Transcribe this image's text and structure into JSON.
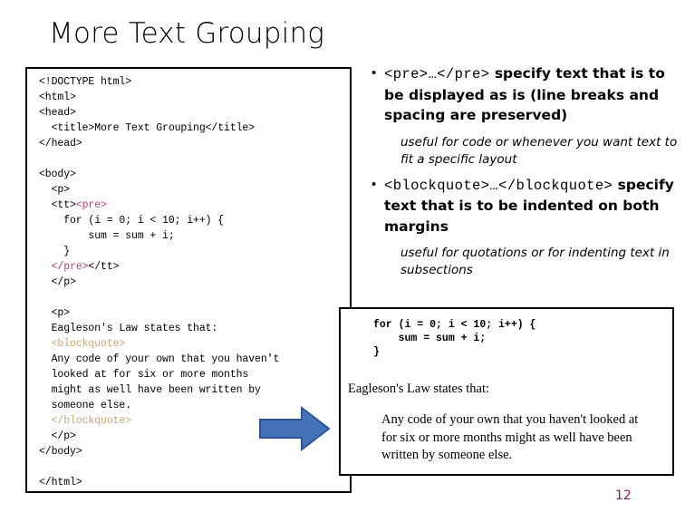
{
  "slide": {
    "title": "More Text Grouping",
    "page_number": "12"
  },
  "code_box": {
    "lines": [
      {
        "text": "<!DOCTYPE html>",
        "style": "plain"
      },
      {
        "text": "<html>",
        "style": "plain"
      },
      {
        "text": "<head>",
        "style": "plain"
      },
      {
        "text": "  <title>More Text Grouping</title>",
        "style": "plain"
      },
      {
        "text": "</head>",
        "style": "plain"
      },
      {
        "text": "",
        "style": "plain"
      },
      {
        "text": "<body>",
        "style": "plain"
      },
      {
        "text": "  <p>",
        "style": "plain"
      },
      {
        "text": "  <tt>",
        "style": "plain",
        "suffix": "<pre>",
        "suffix_style": "pre"
      },
      {
        "text": "    for (i = 0; i < 10; i++) {",
        "style": "plain"
      },
      {
        "text": "        sum = sum + i;",
        "style": "plain"
      },
      {
        "text": "    }",
        "style": "plain"
      },
      {
        "text": "  ",
        "style": "plain",
        "prefix": "</pre>",
        "prefix_style": "pre",
        "after": "</tt>"
      },
      {
        "text": "  </p>",
        "style": "plain"
      },
      {
        "text": "",
        "style": "plain"
      },
      {
        "text": "  <p>",
        "style": "plain"
      },
      {
        "text": "  Eagleson's Law states that:",
        "style": "plain"
      },
      {
        "text": "  <blockquote>",
        "style": "blockquote"
      },
      {
        "text": "  Any code of your own that you haven't",
        "style": "plain"
      },
      {
        "text": "  looked at for six or more months",
        "style": "plain"
      },
      {
        "text": "  might as well have been written by",
        "style": "plain"
      },
      {
        "text": "  someone else.",
        "style": "plain"
      },
      {
        "text": "  </blockquote>",
        "style": "blockquote"
      },
      {
        "text": "  </p>",
        "style": "plain"
      },
      {
        "text": "</body>",
        "style": "plain"
      },
      {
        "text": "",
        "style": "plain"
      },
      {
        "text": "</html>",
        "style": "plain"
      }
    ]
  },
  "bullets": [
    {
      "mono_open": "<pre>",
      "ellipsis": "…",
      "mono_close": "</pre>",
      "rest": " specify text that is to be displayed as is (line breaks and spacing are preserved)",
      "note": "useful for code or whenever you want text to fit a specific layout"
    },
    {
      "mono_open": "<blockquote>",
      "ellipsis": "…",
      "mono_close": "</blockquote>",
      "rest": " specify text that is to be indented on both margins",
      "note": "useful for quotations or for indenting text in subsections"
    }
  ],
  "arrow": {
    "label": "right-arrow",
    "fill": "#4472b8",
    "stroke": "#2e5395"
  },
  "output_box": {
    "code": "for (i = 0; i < 10; i++) {\n    sum = sum + i;\n}",
    "lead": "Eagleson's Law states that:",
    "quote": "Any code of your own that you haven't looked at for six or more months might as well have been written by someone else."
  },
  "colors": {
    "pre_tag": "#bf3f6e",
    "blockquote_tag": "#c9a878",
    "page_number": "#8c2348"
  }
}
